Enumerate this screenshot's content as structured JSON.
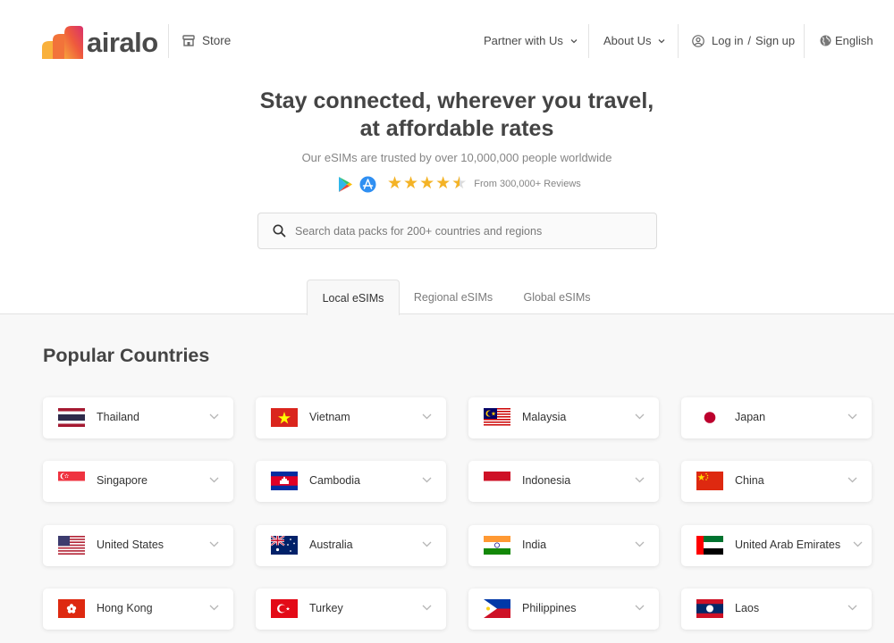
{
  "brand": {
    "name": "airalo"
  },
  "header": {
    "store_label": "Store",
    "nav": {
      "partner": "Partner with Us",
      "about": "About Us",
      "login": "Log in",
      "slash": "/",
      "signup": "Sign up",
      "language": "English"
    }
  },
  "hero": {
    "title_line1": "Stay connected, wherever you travel,",
    "title_line2": "at affordable rates",
    "subtitle": "Our eSIMs are trusted by over 10,000,000 people worldwide",
    "rating_stars": 4.5,
    "reviews": "From 300,000+ Reviews"
  },
  "search": {
    "placeholder": "Search data packs for 200+ countries and regions",
    "value": ""
  },
  "tabs": [
    {
      "label": "Local eSIMs",
      "active": true
    },
    {
      "label": "Regional eSIMs",
      "active": false
    },
    {
      "label": "Global eSIMs",
      "active": false
    }
  ],
  "section": {
    "title": "Popular Countries"
  },
  "countries": [
    {
      "name": "Thailand"
    },
    {
      "name": "Vietnam"
    },
    {
      "name": "Malaysia"
    },
    {
      "name": "Japan"
    },
    {
      "name": "Singapore"
    },
    {
      "name": "Cambodia"
    },
    {
      "name": "Indonesia"
    },
    {
      "name": "China"
    },
    {
      "name": "United States"
    },
    {
      "name": "Australia"
    },
    {
      "name": "India"
    },
    {
      "name": "United Arab Emirates"
    },
    {
      "name": "Hong Kong"
    },
    {
      "name": "Turkey"
    },
    {
      "name": "Philippines"
    },
    {
      "name": "Laos"
    }
  ],
  "colors": {
    "brand_gradient_start": "#f26b3a",
    "brand_gradient_end": "#e2396b",
    "star": "#f4b326",
    "content_bg": "#f8f8f8"
  },
  "icons": {
    "store": "storefront-icon",
    "user": "user-circle-icon",
    "globe": "globe-icon",
    "search": "search-icon",
    "google_play": "google-play-icon",
    "app_store": "app-store-icon",
    "chevron": "chevron-down-icon"
  }
}
